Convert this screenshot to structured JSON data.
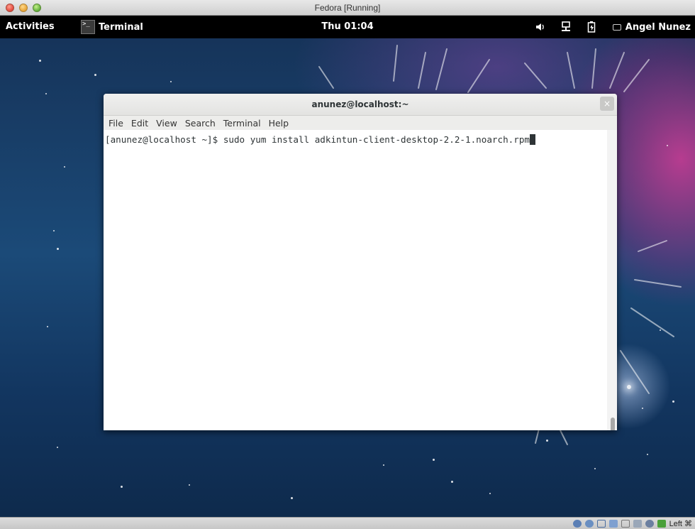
{
  "host": {
    "window_title": "Fedora [Running]",
    "host_key_label": "Left ⌘"
  },
  "gnome": {
    "activities_label": "Activities",
    "app_name": "Terminal",
    "clock": "Thu 01:04",
    "user_name": "Angel Nunez"
  },
  "terminal": {
    "title": "anunez@localhost:~",
    "menu": [
      "File",
      "Edit",
      "View",
      "Search",
      "Terminal",
      "Help"
    ],
    "prompt": "[anunez@localhost ~]$ ",
    "command": "sudo yum install adkintun-client-desktop-2.2-1.noarch.rpm",
    "close_glyph": "×"
  },
  "icons": {
    "volume": "volume-icon",
    "network": "network-wired-icon",
    "battery": "battery-icon",
    "chat": "chat-status-icon"
  },
  "colors": {
    "terminal_fg": "#2e3436",
    "gnome_bar": "#000000",
    "desktop_blue": "#1b4a78",
    "desktop_magenta": "#d23c96"
  }
}
